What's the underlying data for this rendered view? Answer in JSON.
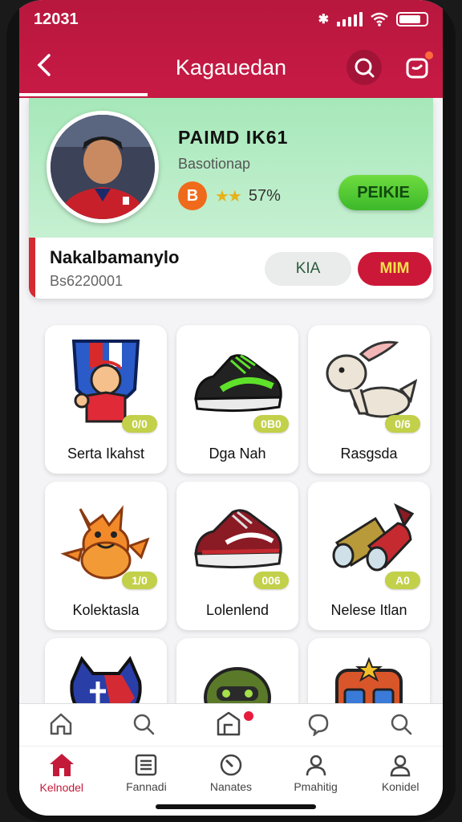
{
  "status": {
    "time": "12031"
  },
  "header": {
    "title": "Kagauedan"
  },
  "profile": {
    "name": "PAIMD IK61",
    "subtitle": "Basotionap",
    "coin_letter": "B",
    "rating_text": "57%",
    "primary_button": "PEIKIE",
    "handle": "Nakalbamanylo",
    "id_text": "Bs6220001",
    "button_grey": "KIA",
    "button_red": "MIM"
  },
  "items": [
    {
      "label": "Serta Ikahst",
      "badge": "0/0"
    },
    {
      "label": "Dga Nah",
      "badge": "0B0"
    },
    {
      "label": "Rasgsda",
      "badge": "0/6"
    },
    {
      "label": "Kolektasla",
      "badge": "1/0"
    },
    {
      "label": "Lolenlend",
      "badge": "006"
    },
    {
      "label": "Nelese Itlan",
      "badge": "A0"
    }
  ],
  "bottom_nav": {
    "items": [
      {
        "label": "Kelnodel",
        "icon": "home-icon"
      },
      {
        "label": "Fannadi",
        "icon": "list-icon"
      },
      {
        "label": "Nanates",
        "icon": "gauge-icon"
      },
      {
        "label": "Pmahitig",
        "icon": "user-icon"
      },
      {
        "label": "Konidel",
        "icon": "profile-icon"
      }
    ]
  },
  "colors": {
    "brand": "#c41a3a",
    "accent_green": "#4cc531"
  }
}
